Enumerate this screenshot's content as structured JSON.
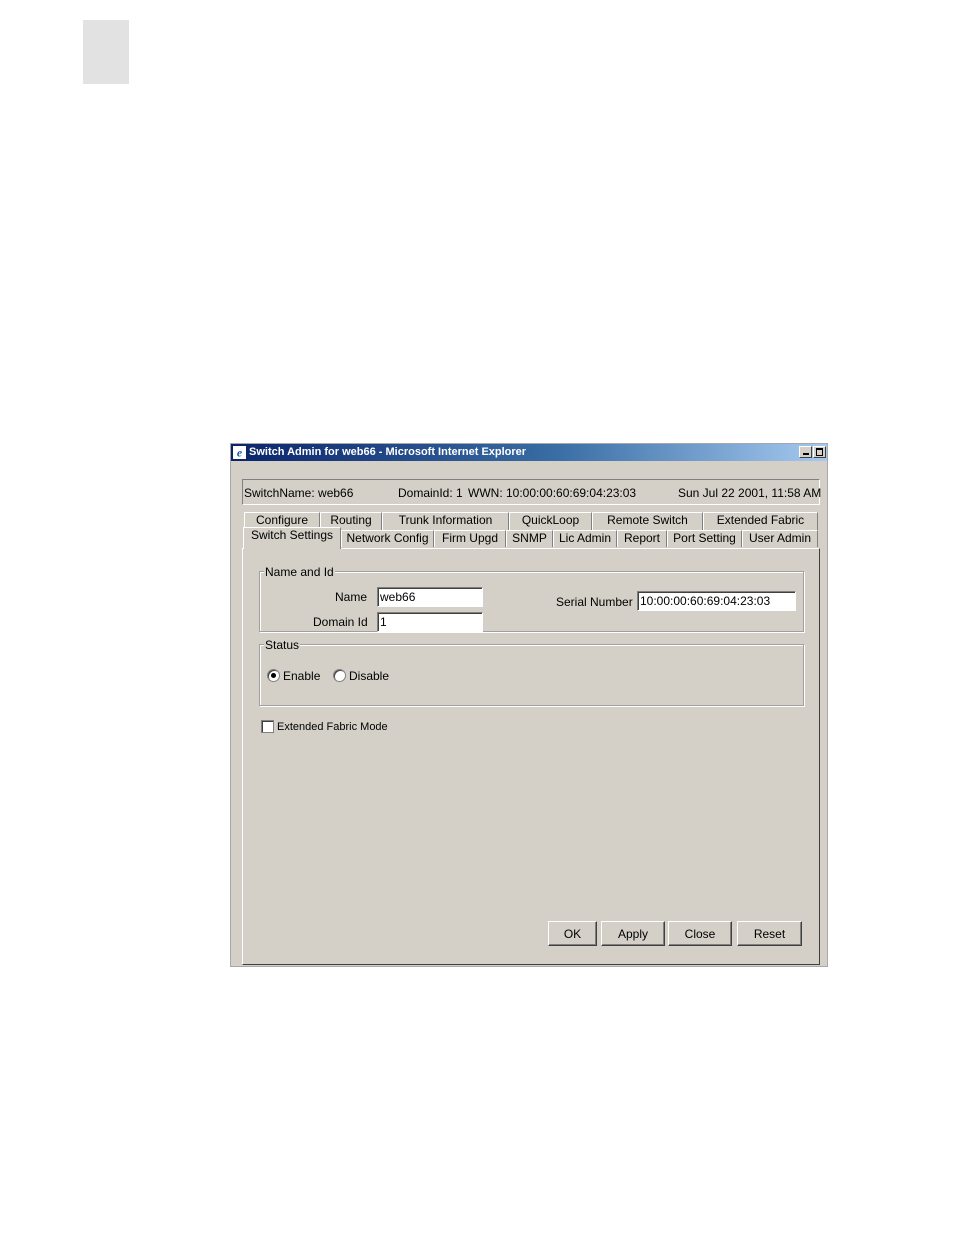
{
  "window": {
    "title": "Switch Admin for web66 - Microsoft Internet Explorer"
  },
  "infobar": {
    "switch_name": "SwitchName: web66",
    "domain_id": "DomainId: 1",
    "wwn": "WWN: 10:00:00:60:69:04:23:03",
    "datetime": "Sun Jul 22  2001, 11:58 AM"
  },
  "tabs": {
    "back_row": [
      "Configure",
      "Routing",
      "Trunk Information",
      "QuickLoop",
      "Remote Switch",
      "Extended Fabric"
    ],
    "front_row": [
      "Switch Settings",
      "Network Config",
      "Firm Upgd",
      "SNMP",
      "Lic Admin",
      "Report",
      "Port Setting",
      "User Admin"
    ],
    "active": "Switch Settings"
  },
  "name_and_id": {
    "legend": "Name and Id",
    "name_label": "Name",
    "name_value": "web66",
    "domain_label": "Domain Id",
    "domain_value": "1",
    "serial_label": "Serial Number",
    "serial_value": "10:00:00:60:69:04:23:03"
  },
  "status": {
    "legend": "Status",
    "enable_label": "Enable",
    "disable_label": "Disable",
    "selected": "Enable"
  },
  "extended_fabric": {
    "label": "Extended Fabric Mode",
    "checked": false
  },
  "buttons": {
    "ok": "OK",
    "apply": "Apply",
    "close": "Close",
    "reset": "Reset"
  }
}
